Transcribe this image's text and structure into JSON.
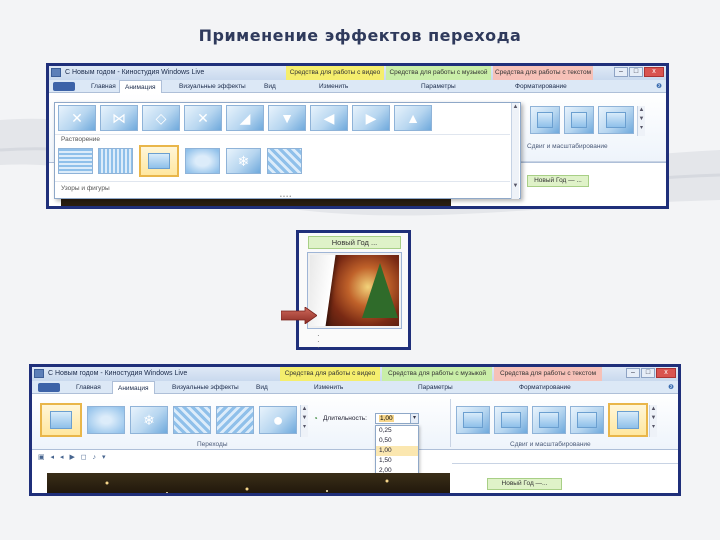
{
  "slide_title": "Применение эффектов перехода",
  "window_top": {
    "title": "С Новым годом - Киностудия Windows Live",
    "context_video": "Средства для работы с видео",
    "context_music": "Средства для работы с музыкой",
    "context_text": "Средства для работы с текстом",
    "tabs": [
      "Главная",
      "Анимация",
      "Визуальные эффекты",
      "Вид",
      "Изменить",
      "Параметры",
      "Форматирование"
    ],
    "section_dissolve": "Растворение",
    "section_patterns": "Узоры и фигуры",
    "group_pan_zoom": "Сдвиг и масштабирование",
    "timeline_label": "Новый Год — ..."
  },
  "thumbnail": {
    "label": "Новый Год ..."
  },
  "window_bottom": {
    "title": "С Новым годом - Киностудия Windows Live",
    "context_video": "Средства для работы с видео",
    "context_music": "Средства для работы с музыкой",
    "context_text": "Средства для работы с текстом",
    "tabs": [
      "Главная",
      "Анимация",
      "Визуальные эффекты",
      "Вид",
      "Изменить",
      "Параметры",
      "Форматирование"
    ],
    "duration_label": "Длительность:",
    "duration_value": "1,00",
    "duration_options": [
      "0,25",
      "0,50",
      "1,00",
      "1,50",
      "2,00"
    ],
    "group_transitions": "Переходы",
    "group_pan_zoom": "Сдвиг и масштабирование",
    "timeline_label": "Новый Год —..."
  },
  "colors": {
    "frame_border": "#1f2f7a",
    "context_video": "#f5ee6d",
    "context_music": "#c9eea8",
    "context_text": "#f6c1b8",
    "selection": "#e9b64a",
    "arrow": "#b33a32"
  }
}
